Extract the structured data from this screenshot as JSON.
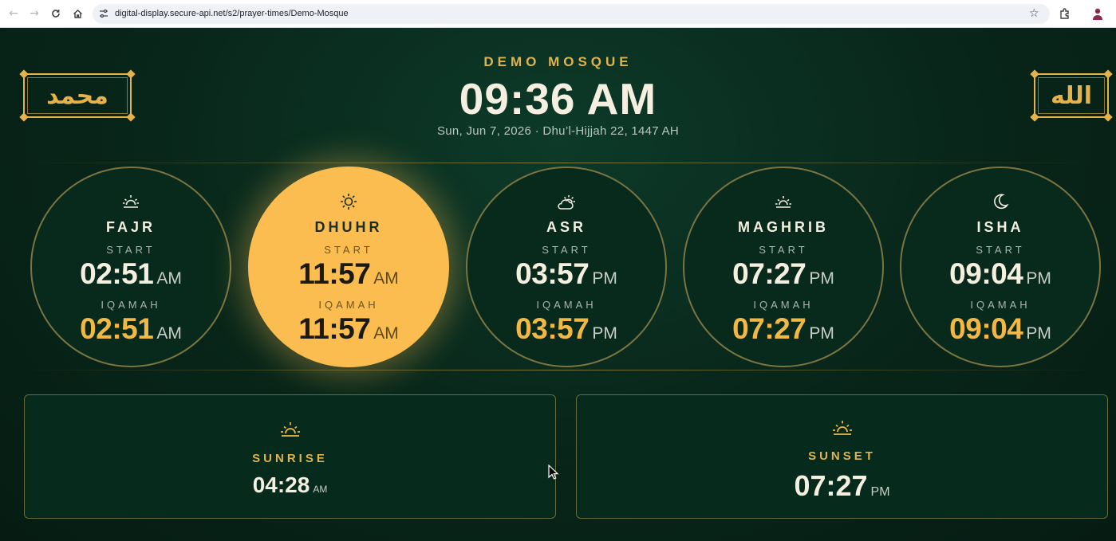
{
  "browser": {
    "url": "digital-display.secure-api.net/s2/prayer-times/Demo-Mosque"
  },
  "header": {
    "mosque_name": "DEMO MOSQUE",
    "clock": "09:36 AM",
    "date_line": "Sun, Jun 7, 2026 · Dhu’l-Hijjah 22, 1447 AH",
    "left_calligraphy": "محمد",
    "right_calligraphy": "الله"
  },
  "labels": {
    "start": "START",
    "iqamah": "IQAMAH"
  },
  "prayers": [
    {
      "name": "FAJR",
      "icon": "sunrise-icon",
      "start_time": "02:51",
      "start_ampm": "AM",
      "iqamah_time": "02:51",
      "iqamah_ampm": "AM",
      "active": false
    },
    {
      "name": "DHUHR",
      "icon": "sun-icon",
      "start_time": "11:57",
      "start_ampm": "AM",
      "iqamah_time": "11:57",
      "iqamah_ampm": "AM",
      "active": true
    },
    {
      "name": "ASR",
      "icon": "partly-cloudy-icon",
      "start_time": "03:57",
      "start_ampm": "PM",
      "iqamah_time": "03:57",
      "iqamah_ampm": "PM",
      "active": false
    },
    {
      "name": "MAGHRIB",
      "icon": "sunset-icon",
      "start_time": "07:27",
      "start_ampm": "PM",
      "iqamah_time": "07:27",
      "iqamah_ampm": "PM",
      "active": false
    },
    {
      "name": "ISHA",
      "icon": "moon-icon",
      "start_time": "09:04",
      "start_ampm": "PM",
      "iqamah_time": "09:04",
      "iqamah_ampm": "PM",
      "active": false
    }
  ],
  "sun_times": {
    "sunrise": {
      "label": "SUNRISE",
      "time": "04:28",
      "ampm": "AM",
      "icon": "sunrise-icon"
    },
    "sunset": {
      "label": "SUNSET",
      "time": "07:27",
      "ampm": "PM",
      "icon": "sunset-icon"
    }
  },
  "colors": {
    "accent_gold": "#e1b34f",
    "active_prayer": "#fbbc50",
    "background": "#082519"
  }
}
